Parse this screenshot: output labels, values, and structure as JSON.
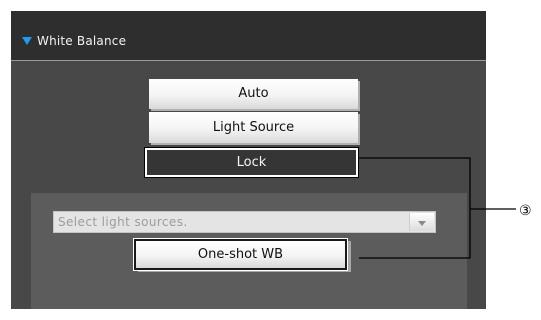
{
  "section": {
    "title": "White Balance"
  },
  "buttons": {
    "auto": "Auto",
    "light_source": "Light Source",
    "lock": "Lock",
    "one_shot": "One-shot WB"
  },
  "light_source_select": {
    "placeholder": "Select light sources."
  },
  "callout": {
    "label": "③"
  },
  "colors": {
    "expand_arrow": "#1e9cf0",
    "panel_background": "#484848",
    "header_background": "#2e2e2e"
  }
}
